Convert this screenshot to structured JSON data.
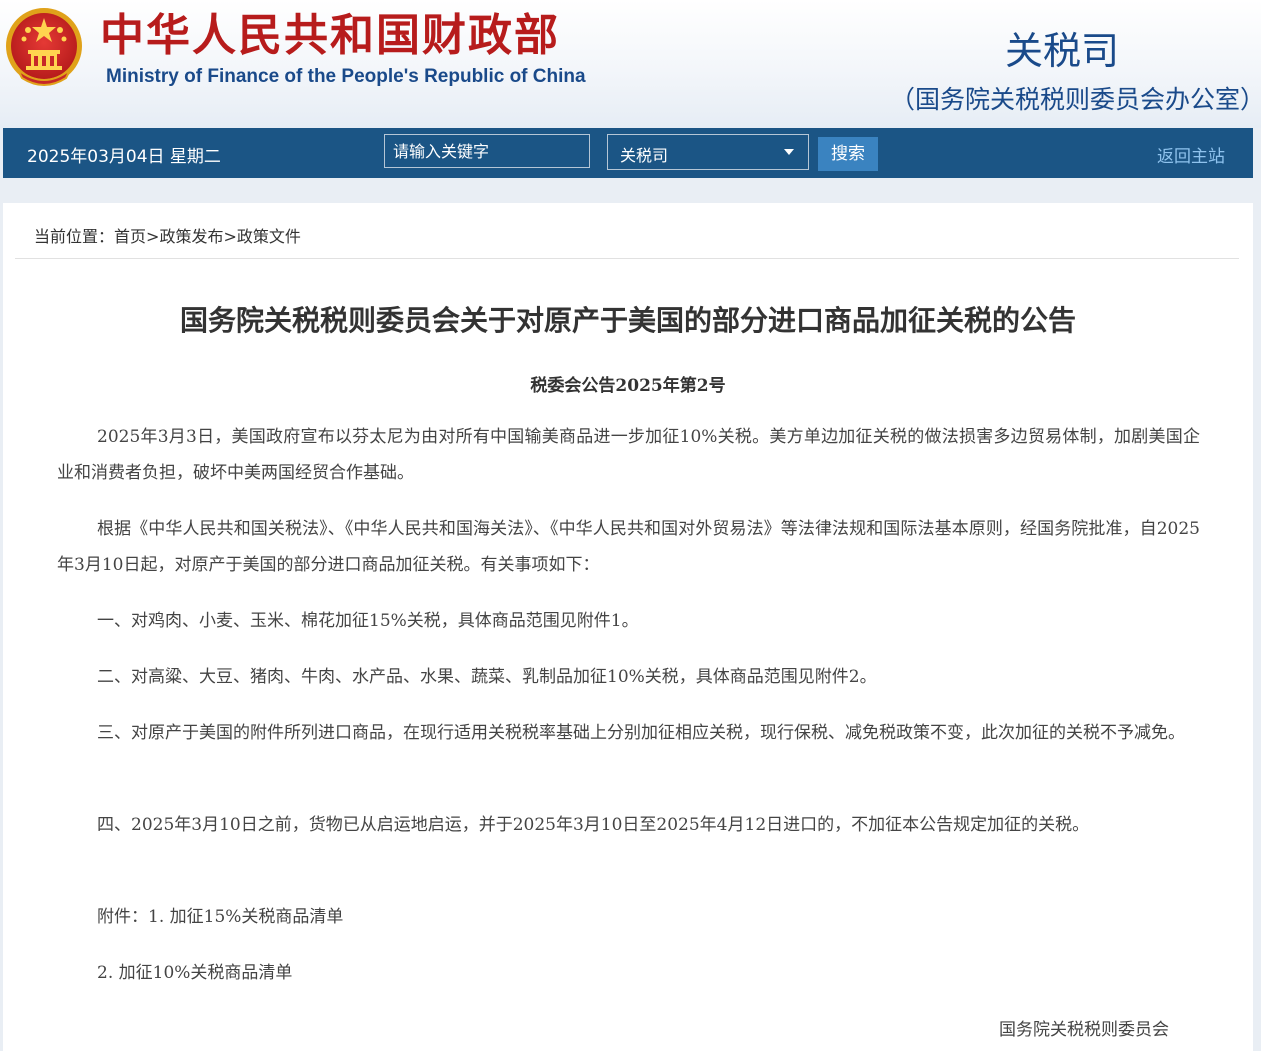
{
  "header": {
    "ministry_cn": "中华人民共和国财政部",
    "ministry_en": "Ministry of Finance of the People's Republic of China",
    "department": "关税司",
    "department_sub": "（国务院关税税则委员会办公室）",
    "emblem_icon": "national-emblem-icon"
  },
  "nav": {
    "date": "2025年03月04日  星期二",
    "search_placeholder": "请输入关键字",
    "scope_selected": "关税司",
    "search_button": "搜索",
    "home_link": "返回主站"
  },
  "breadcrumb": {
    "prefix": "当前位置：",
    "items": [
      "首页",
      "政策发布",
      "政策文件"
    ],
    "separator": ">"
  },
  "article": {
    "title": "国务院关税税则委员会关于对原产于美国的部分进口商品加征关税的公告",
    "doc_number": "税委会公告2025年第2号",
    "paragraphs": [
      "2025年3月3日，美国政府宣布以芬太尼为由对所有中国输美商品进一步加征10%关税。美方单边加征关税的做法损害多边贸易体制，加剧美国企业和消费者负担，破坏中美两国经贸合作基础。",
      "根据《中华人民共和国关税法》、《中华人民共和国海关法》、《中华人民共和国对外贸易法》等法律法规和国际法基本原则，经国务院批准，自2025年3月10日起，对原产于美国的部分进口商品加征关税。有关事项如下：",
      "一、对鸡肉、小麦、玉米、棉花加征15%关税，具体商品范围见附件1。",
      "二、对高粱、大豆、猪肉、牛肉、水产品、水果、蔬菜、乳制品加征10%关税，具体商品范围见附件2。",
      "三、对原产于美国的附件所列进口商品，在现行适用关税税率基础上分别加征相应关税，现行保税、减免税政策不变，此次加征的关税不予减免。",
      "四、2025年3月10日之前，货物已从启运地启运，并于2025年3月10日至2025年4月12日进口的，不加征本公告规定加征的关税。",
      "附件：1. 加征15%关税商品清单",
      "2. 加征10%关税商品清单"
    ],
    "signature": "国务院关税税则委员会"
  },
  "colors": {
    "nav_bg": "#1b5585",
    "ministry_red": "#b71c1c",
    "brand_blue": "#1a4a8a",
    "search_button_bg": "#3a83c0",
    "home_link": "#8fc3ee"
  }
}
